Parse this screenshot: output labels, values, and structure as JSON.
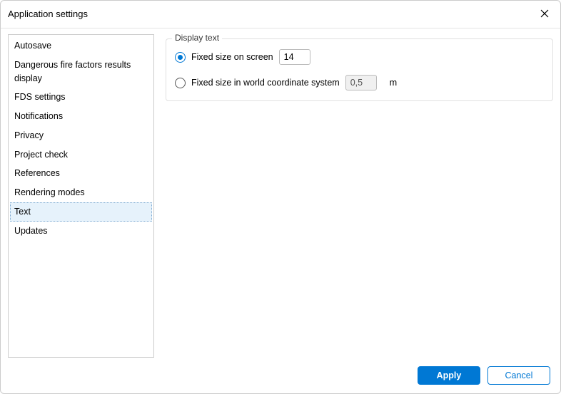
{
  "window": {
    "title": "Application settings"
  },
  "sidebar": {
    "items": [
      {
        "label": "Autosave"
      },
      {
        "label": "Dangerous fire factors results display"
      },
      {
        "label": "FDS settings"
      },
      {
        "label": "Notifications"
      },
      {
        "label": "Privacy"
      },
      {
        "label": "Project check"
      },
      {
        "label": "References"
      },
      {
        "label": "Rendering modes"
      },
      {
        "label": "Text"
      },
      {
        "label": "Updates"
      }
    ],
    "selected_index": 8
  },
  "display_text_group": {
    "title": "Display text",
    "option_screen": {
      "label": "Fixed size on screen",
      "value": "14",
      "checked": true
    },
    "option_world": {
      "label": "Fixed size in world coordinate system",
      "value": "0,5",
      "unit": "m",
      "checked": false
    }
  },
  "footer": {
    "apply": "Apply",
    "cancel": "Cancel"
  }
}
